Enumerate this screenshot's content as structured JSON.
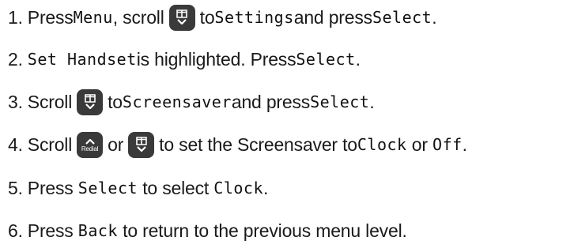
{
  "steps": [
    {
      "number": "1.",
      "t1": "Press ",
      "lcd1": "Menu",
      "t2": ", scroll",
      "t3": "to ",
      "lcd2": "Settings",
      "t4": " and press ",
      "lcd3": "Select",
      "t5": "."
    },
    {
      "number": "2.",
      "lcd1": "Set Handset",
      "t1": " is highlighted. Press ",
      "lcd2": "Select",
      "t2": "."
    },
    {
      "number": "3.",
      "t1": "Scroll",
      "t2": "to ",
      "lcd1": "Screensaver",
      "t3": " and press ",
      "lcd2": "Select",
      "t4": "."
    },
    {
      "number": "4.",
      "t1": "Scroll",
      "t2": "or",
      "t3": "to set the Screensaver to ",
      "lcd1": "Clock",
      "t4": " or ",
      "lcd2": "Off",
      "t5": "."
    },
    {
      "number": "5.",
      "t1": "Press ",
      "lcd1": "Select",
      "t2": " to select ",
      "lcd2": "Clock",
      "t3": "."
    },
    {
      "number": "6.",
      "t1": "Press ",
      "lcd1": "Back",
      "t2": " to return to the previous menu level."
    }
  ],
  "keys": {
    "redial_label": "Redial",
    "scroll_down_icon": "phonebook-down-key-icon",
    "scroll_up_icon": "redial-up-key-icon"
  },
  "colors": {
    "text": "#1a1a1a",
    "key_background": "#3a3a3a",
    "key_foreground": "#ffffff"
  }
}
